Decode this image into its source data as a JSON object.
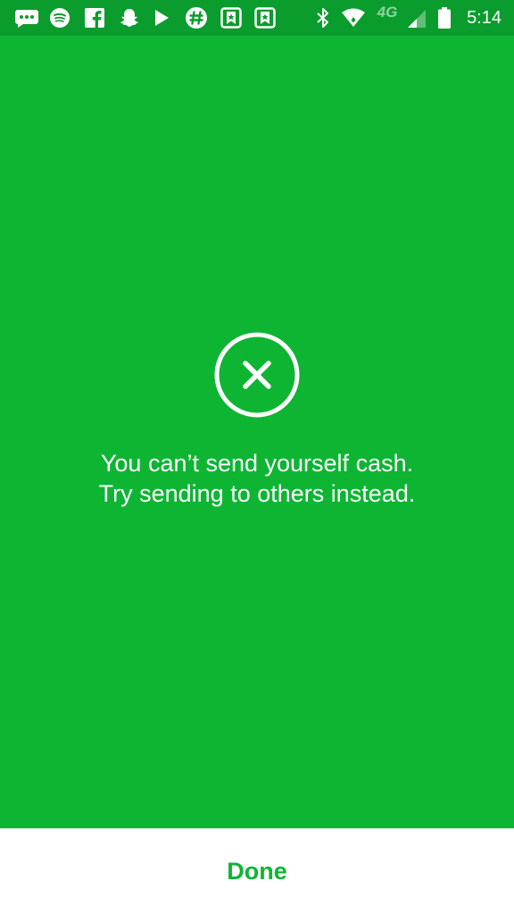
{
  "status_bar": {
    "time": "5:14",
    "network_label": "4G",
    "notification_icons": [
      "messages-icon",
      "spotify-icon",
      "facebook-icon",
      "snapchat-icon",
      "play-store-icon",
      "slack-icon",
      "bookmark-app-icon",
      "bookmark-app-icon"
    ],
    "system_icons": [
      "bluetooth-icon",
      "wifi-icon",
      "cell-signal-icon",
      "battery-icon"
    ]
  },
  "error_screen": {
    "icon": "close-circle-icon",
    "message_line_1": "You can’t send yourself cash.",
    "message_line_2": "Try sending to others instead."
  },
  "footer": {
    "done_label": "Done"
  },
  "colors": {
    "brand_green": "#0db533",
    "status_bar_green": "#0a9c2c",
    "white": "#ffffff"
  }
}
